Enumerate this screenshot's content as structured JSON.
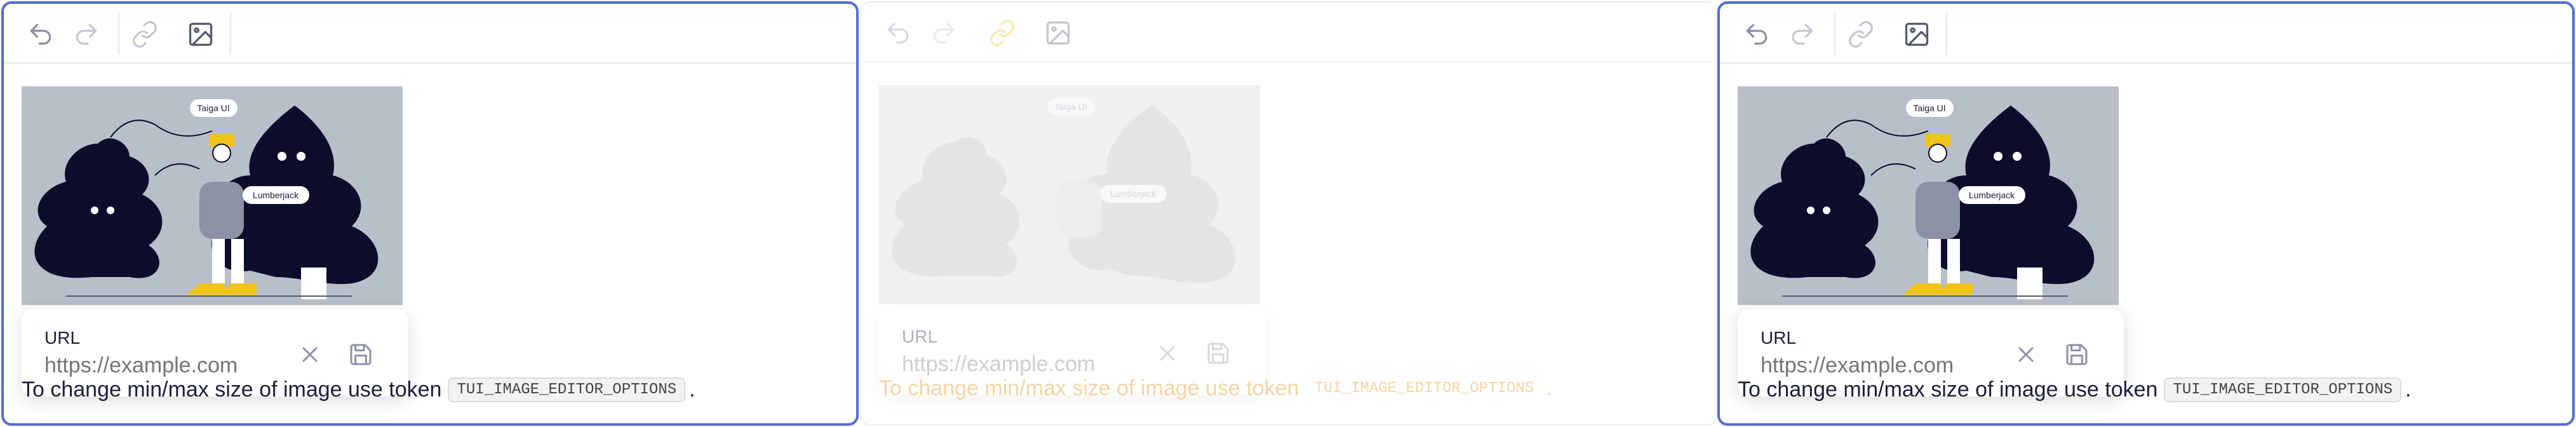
{
  "editors": [
    {
      "state": "focused",
      "image": {
        "callouts": [
          "Taiga UI",
          "Lumberjack"
        ]
      },
      "popup": {
        "label": "URL",
        "placeholder": "https://example.com",
        "value": ""
      },
      "text": "To change min/max size of image use token",
      "token": "TUI_IMAGE_EDITOR_OPTIONS",
      "trailing": "."
    },
    {
      "state": "disabled",
      "image": {
        "callouts": [
          "Taiga UI",
          "Lumberjack"
        ]
      },
      "popup": {
        "label": "URL",
        "placeholder": "https://example.com",
        "value": ""
      },
      "text": "To change min/max size of image use token",
      "token": "TUI_IMAGE_EDITOR_OPTIONS",
      "trailing": "."
    },
    {
      "state": "focused",
      "image": {
        "callouts": [
          "Taiga UI",
          "Lumberjack"
        ]
      },
      "popup": {
        "label": "URL",
        "placeholder": "https://example.com",
        "value": ""
      },
      "text": "To change min/max size of image use token",
      "token": "TUI_IMAGE_EDITOR_OPTIONS",
      "trailing": "."
    }
  ],
  "toolbar_icons": [
    "undo-icon",
    "redo-icon",
    "link-icon",
    "image-icon"
  ],
  "colors": {
    "focus_border": "#526ed3",
    "tree": "#0c0d2c",
    "hat": "#f0c419",
    "background_image": "#b9bfc9",
    "disabled_text": "#e08a00"
  }
}
